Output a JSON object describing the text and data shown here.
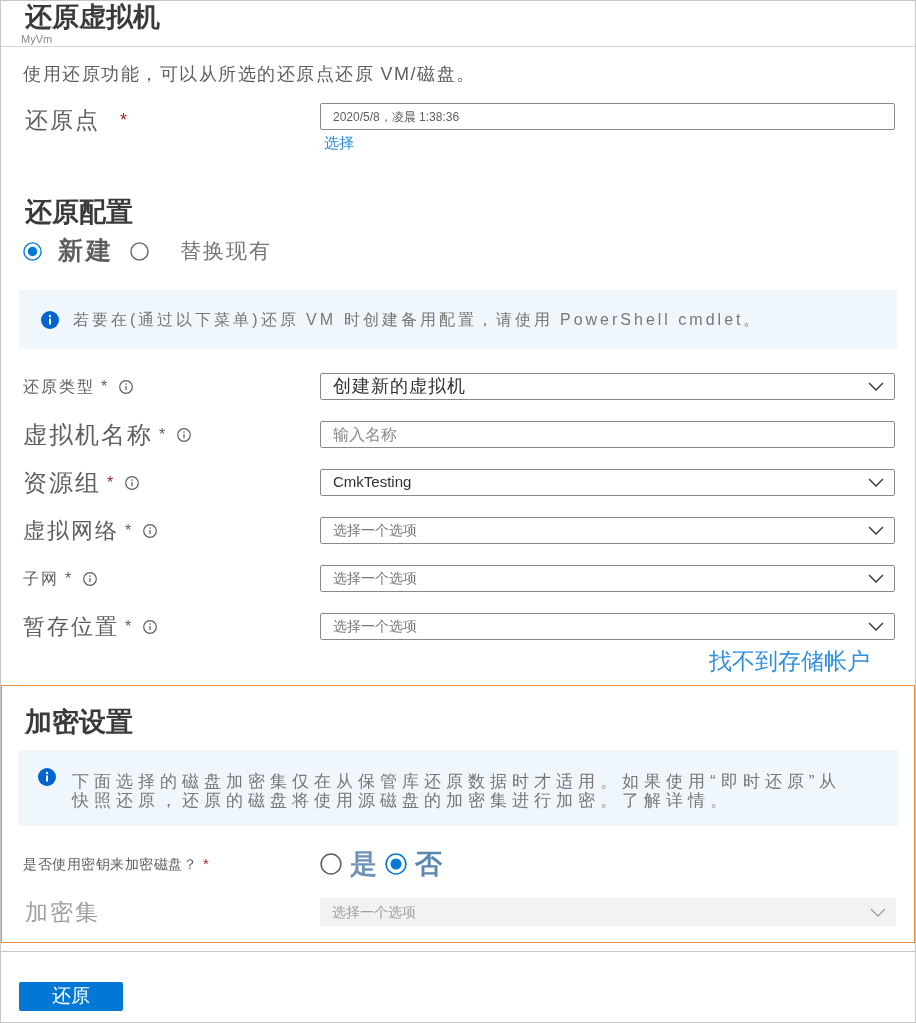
{
  "header": {
    "title": "还原虚拟机",
    "subtitle": "MyVm"
  },
  "description": "使用还原功能，可以从所选的还原点还原 VM/磁盘。",
  "restore_point": {
    "label": "还原点",
    "required_mark": "*",
    "mark_accent": true,
    "value": "2020/5/8，凌晨 1:38:36",
    "link": "选择"
  },
  "restore_config": {
    "title": "还原配置",
    "options": [
      {
        "label": "新建",
        "selected": true
      },
      {
        "label": "替换现有",
        "selected": false
      }
    ],
    "info": "若要在(通过以下菜单)还原 VM 时创建备用配置，请使用 PowerShell cmdlet。"
  },
  "fields": [
    {
      "kind": "dropdown",
      "label": "还原类型",
      "required_mark": "*",
      "mark_accent": false,
      "value": "创建新的虚拟机"
    },
    {
      "kind": "text",
      "label": "虚拟机名称",
      "required_mark": "*",
      "mark_accent": false,
      "placeholder": "输入名称"
    },
    {
      "kind": "dropdown",
      "label": "资源组",
      "required_mark": "*",
      "mark_accent": true,
      "value": "CmkTesting"
    },
    {
      "kind": "dropdown",
      "label": "虚拟网络",
      "required_mark": "*",
      "mark_accent": false,
      "placeholder": "选择一个选项"
    },
    {
      "kind": "dropdown",
      "label": "子网",
      "required_mark": "*",
      "mark_accent": false,
      "placeholder": "选择一个选项"
    },
    {
      "kind": "dropdown",
      "label": "暂存位置",
      "required_mark": "*",
      "mark_accent": false,
      "placeholder": "选择一个选项"
    }
  ],
  "storage_link": "找不到存储帐户",
  "encryption": {
    "title": "加密设置",
    "info": "下面选择的磁盘加密集仅在从保管库还原数据时才适用。如果使用“即时还原”从快照还原，还原的磁盘将使用源磁盘的加密集进行加密。了解详情。",
    "question": {
      "label": "是否使用密钥来加密磁盘？",
      "required_mark": "*",
      "mark_accent": true,
      "options": [
        {
          "label": "是",
          "selected": false
        },
        {
          "label": "否",
          "selected": true
        }
      ]
    },
    "encryption_set": {
      "label": "加密集",
      "placeholder": "选择一个选项",
      "disabled": true
    }
  },
  "buttons": [
    {
      "label": "还原"
    }
  ]
}
